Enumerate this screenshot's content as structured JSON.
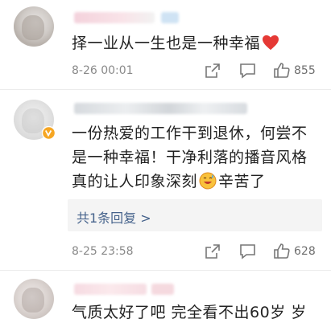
{
  "comments": [
    {
      "text": "择一业从一生也是一种幸福",
      "emoji": "red-heart",
      "time": "8-26 00:01",
      "like_count": "855"
    },
    {
      "line1": "一份热爱的工作干到退休，何尝不",
      "line2": "是一种幸福！干净利落的播音风格",
      "line3": "真的让人印象深刻",
      "line3_tail": "辛苦了",
      "emoji": "sweating-smile",
      "reply_summary": "共1条回复 >",
      "time": "8-25 23:58",
      "like_count": "628"
    },
    {
      "text": "气质太好了吧 完全看不出60岁 岁"
    }
  ],
  "colors": {
    "heart": "#e53935",
    "reply_link": "#46638c",
    "verified_badge": "#f6a623"
  }
}
